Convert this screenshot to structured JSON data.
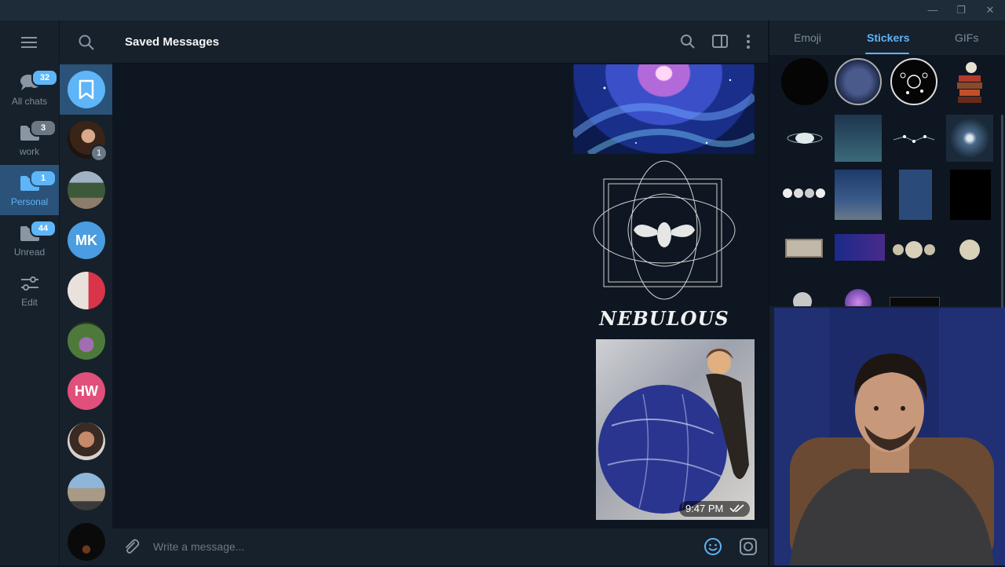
{
  "window": {
    "minimize_glyph": "—",
    "restore_glyph": "❐",
    "close_glyph": "✕"
  },
  "folders": [
    {
      "label": "All chats",
      "badge": "32",
      "icon": "chats-icon"
    },
    {
      "label": "work",
      "badge": "3",
      "icon": "folder-icon"
    },
    {
      "label": "Personal",
      "badge": "1",
      "icon": "folder-icon",
      "active": true
    },
    {
      "label": "Unread",
      "badge": "44",
      "icon": "folder-icon"
    },
    {
      "label": "Edit",
      "icon": "sliders-icon"
    }
  ],
  "chats": [
    {
      "type": "saved",
      "icon": "bookmark-icon"
    },
    {
      "type": "photo",
      "unread": "1"
    },
    {
      "type": "photo"
    },
    {
      "type": "initials",
      "initials": "MK",
      "color": "#4a9de0"
    },
    {
      "type": "photo"
    },
    {
      "type": "photo"
    },
    {
      "type": "initials",
      "initials": "HW",
      "color": "#e0507a"
    },
    {
      "type": "photo"
    },
    {
      "type": "photo"
    },
    {
      "type": "photo"
    }
  ],
  "header": {
    "title": "Saved Messages"
  },
  "messages": {
    "time": "9:47 PM",
    "status_icon": "double-check-icon",
    "sticker_text": "NEBULOUS"
  },
  "composer": {
    "placeholder": "Write a message..."
  },
  "panel": {
    "tabs": [
      {
        "label": "Emoji"
      },
      {
        "label": "Stickers",
        "active": true
      },
      {
        "label": "GIFs"
      }
    ]
  },
  "colors": {
    "accent": "#5eb5f7",
    "active_bg": "#2b5278",
    "sidebar_bg": "#17212b",
    "chat_bg": "#0e1621"
  }
}
